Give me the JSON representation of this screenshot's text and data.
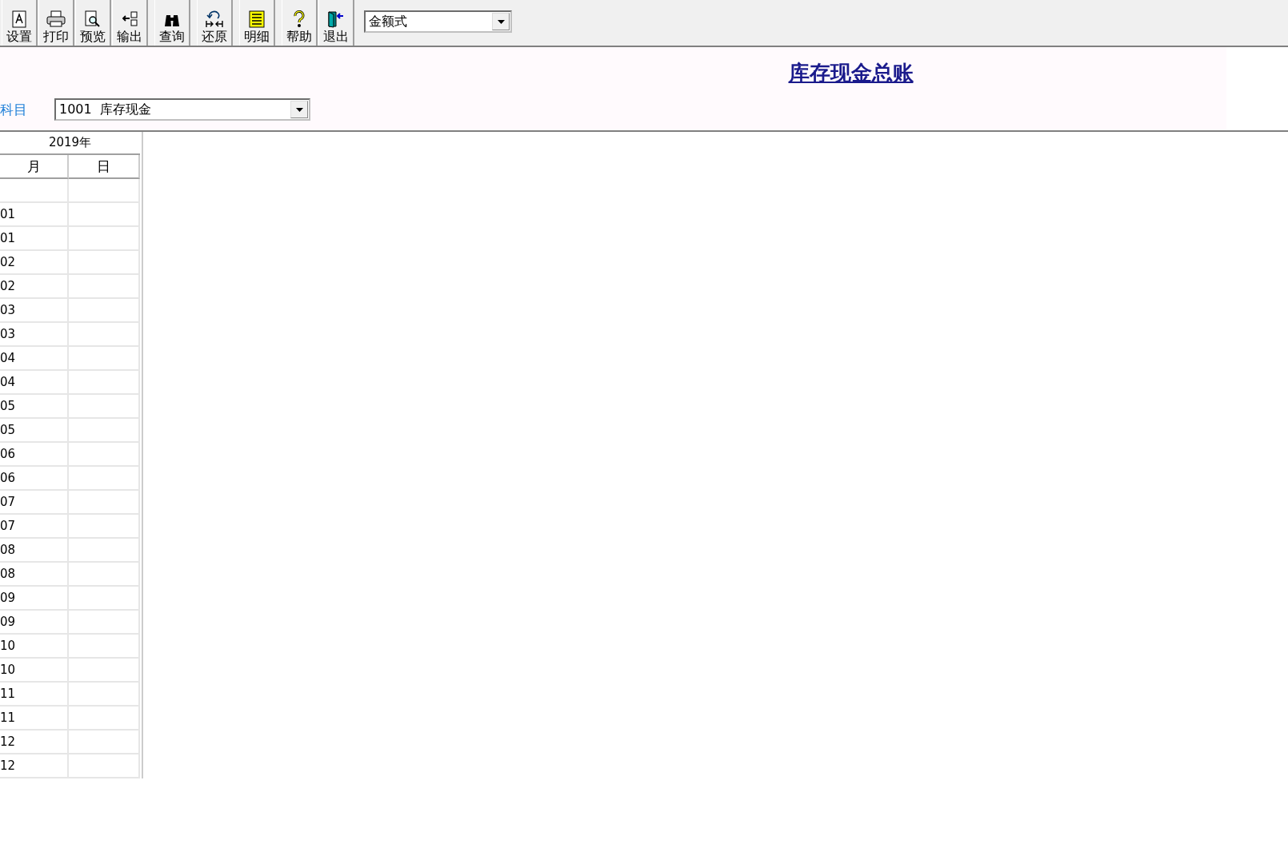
{
  "toolbar": {
    "groups": [
      [
        {
          "label": "设置",
          "kind": "setup"
        },
        {
          "label": "打印",
          "kind": "print"
        },
        {
          "label": "预览",
          "kind": "preview"
        },
        {
          "label": "输出",
          "kind": "export"
        }
      ],
      [
        {
          "label": "查询",
          "kind": "find"
        }
      ],
      [
        {
          "label": "还原",
          "kind": "restore"
        }
      ],
      [
        {
          "label": "明细",
          "kind": "detail"
        }
      ],
      [
        {
          "label": "帮助",
          "kind": "help"
        },
        {
          "label": "退出",
          "kind": "exit"
        }
      ]
    ],
    "format_select": {
      "value": "金额式"
    }
  },
  "report": {
    "title": "库存现金总账",
    "subject_label": "科目",
    "subject_select": {
      "value": "1001  库存现金"
    }
  },
  "table": {
    "year_header": "2019年",
    "columns": [
      "月",
      "日"
    ],
    "rows": [
      {
        "month": "01"
      },
      {
        "month": "01"
      },
      {
        "month": "02"
      },
      {
        "month": "02"
      },
      {
        "month": "03"
      },
      {
        "month": "03"
      },
      {
        "month": "04"
      },
      {
        "month": "04"
      },
      {
        "month": "05"
      },
      {
        "month": "05"
      },
      {
        "month": "06"
      },
      {
        "month": "06"
      },
      {
        "month": "07"
      },
      {
        "month": "07"
      },
      {
        "month": "08"
      },
      {
        "month": "08"
      },
      {
        "month": "09"
      },
      {
        "month": "09"
      },
      {
        "month": "10"
      },
      {
        "month": "10"
      },
      {
        "month": "11"
      },
      {
        "month": "11"
      },
      {
        "month": "12"
      },
      {
        "month": "12"
      }
    ]
  }
}
